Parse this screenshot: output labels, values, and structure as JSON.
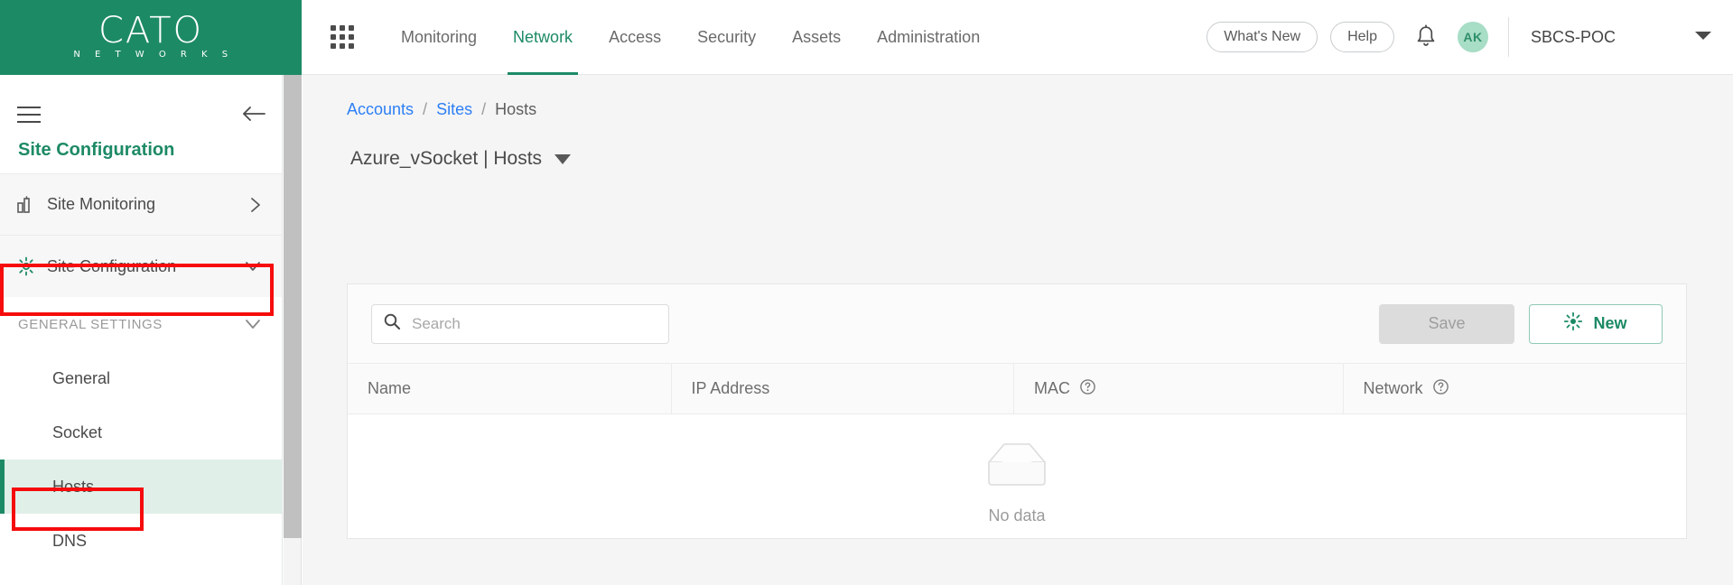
{
  "brand": {
    "name": "CATO",
    "sub": "N E T W O R K S"
  },
  "header": {
    "app_grid_icon": "app-grid-icon",
    "nav": [
      {
        "label": "Monitoring",
        "active": false
      },
      {
        "label": "Network",
        "active": true
      },
      {
        "label": "Access",
        "active": false
      },
      {
        "label": "Security",
        "active": false
      },
      {
        "label": "Assets",
        "active": false
      },
      {
        "label": "Administration",
        "active": false
      }
    ],
    "whats_new": "What's New",
    "help": "Help",
    "bell_icon": "notification-bell-icon",
    "avatar_initials": "AK",
    "account_name": "SBCS-POC",
    "account_caret_icon": "chevron-down-icon"
  },
  "sidebar": {
    "hamburger_icon": "hamburger-menu-icon",
    "back_icon": "arrow-left-icon",
    "title": "Site Configuration",
    "rows": [
      {
        "label": "Site Monitoring",
        "icon": "bar-chart-icon",
        "chevron": "chevron-right-icon"
      },
      {
        "label": "Site Configuration",
        "icon": "gear-icon",
        "chevron": "chevron-down-icon"
      }
    ],
    "section": {
      "label": "GENERAL SETTINGS",
      "chevron": "chevron-down-icon"
    },
    "items": [
      {
        "label": "General",
        "selected": false
      },
      {
        "label": "Socket",
        "selected": false
      },
      {
        "label": "Hosts",
        "selected": true
      },
      {
        "label": "DNS",
        "selected": false
      }
    ]
  },
  "breadcrumb": {
    "accounts": "Accounts",
    "sites": "Sites",
    "current": "Hosts",
    "separator": "/"
  },
  "page": {
    "title": "Azure_vSocket | Hosts",
    "caret_icon": "caret-down-icon"
  },
  "toolbar": {
    "search_placeholder": "Search",
    "search_value": "",
    "search_icon": "search-icon",
    "save_label": "Save",
    "new_label": "New",
    "new_icon": "sparkle-icon"
  },
  "table": {
    "columns": [
      {
        "label": "Name",
        "help": false
      },
      {
        "label": "IP Address",
        "help": false
      },
      {
        "label": "MAC",
        "help": true,
        "help_icon": "question-circle-icon"
      },
      {
        "label": "Network",
        "help": true,
        "help_icon": "question-circle-icon"
      }
    ],
    "rows": [],
    "empty_label": "No data",
    "empty_icon": "empty-inbox-icon"
  },
  "colors": {
    "brand_green": "#1d8a66",
    "link_blue": "#2d7ff5",
    "annotation_red": "#f60c0c",
    "selected_row_bg": "#e0f0e9"
  }
}
